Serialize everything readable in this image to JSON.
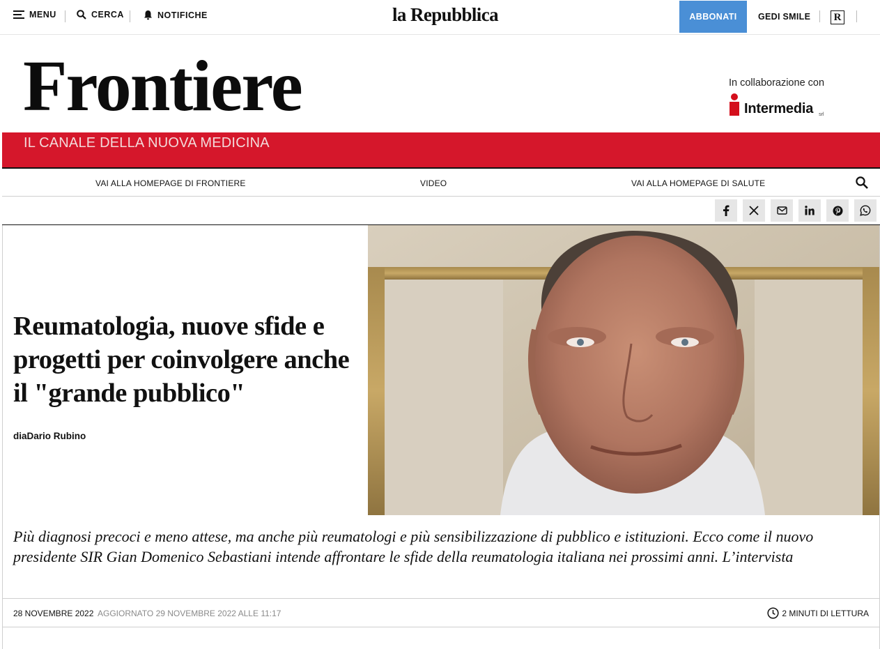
{
  "topbar": {
    "menu_label": "MENU",
    "search_label": "CERCA",
    "notifications_label": "NOTIFICHE",
    "logo": "la Repubblica",
    "subscribe_label": "ABBONATI",
    "gedi_label": "GEDI SMILE",
    "r_badge": "R"
  },
  "banner": {
    "title": "Frontiere",
    "subtitle": "IL CANALE DELLA NUOVA MEDICINA",
    "collab_text": "In collaborazione con",
    "partner": "Intermedia",
    "partner_suffix": "srl"
  },
  "section_nav": {
    "items": [
      {
        "label": "VAI ALLA HOMEPAGE DI FRONTIERE"
      },
      {
        "label": "VIDEO"
      },
      {
        "label": "VAI ALLA HOMEPAGE DI SALUTE"
      }
    ]
  },
  "share": {
    "icons": [
      "facebook-icon",
      "x-icon",
      "mail-icon",
      "linkedin-icon",
      "pinterest-icon",
      "whatsapp-icon"
    ]
  },
  "article": {
    "headline": "Reumatologia, nuove sfide e progetti per coinvolgere anche il \"grande pubblico\"",
    "byline": "diaDario Rubino",
    "summary": "Più diagnosi precoci e meno attese, ma anche più reumatologi e più sensibilizzazione di pubblico e istituzioni. Ecco come il nuovo presidente SIR Gian Domenico Sebastiani intende affrontare le sfide della reumatologia italiana nei prossimi anni. L’intervista",
    "date": "28 NOVEMBRE 2022",
    "updated": "AGGIORNATO 29 NOVEMBRE 2022 ALLE 11:17",
    "read_time": "2 MINUTI DI LETTURA"
  },
  "colors": {
    "accent_blue": "#4a8fd6",
    "banner_red": "#d5172b",
    "share_bg": "#e6e6e6"
  }
}
